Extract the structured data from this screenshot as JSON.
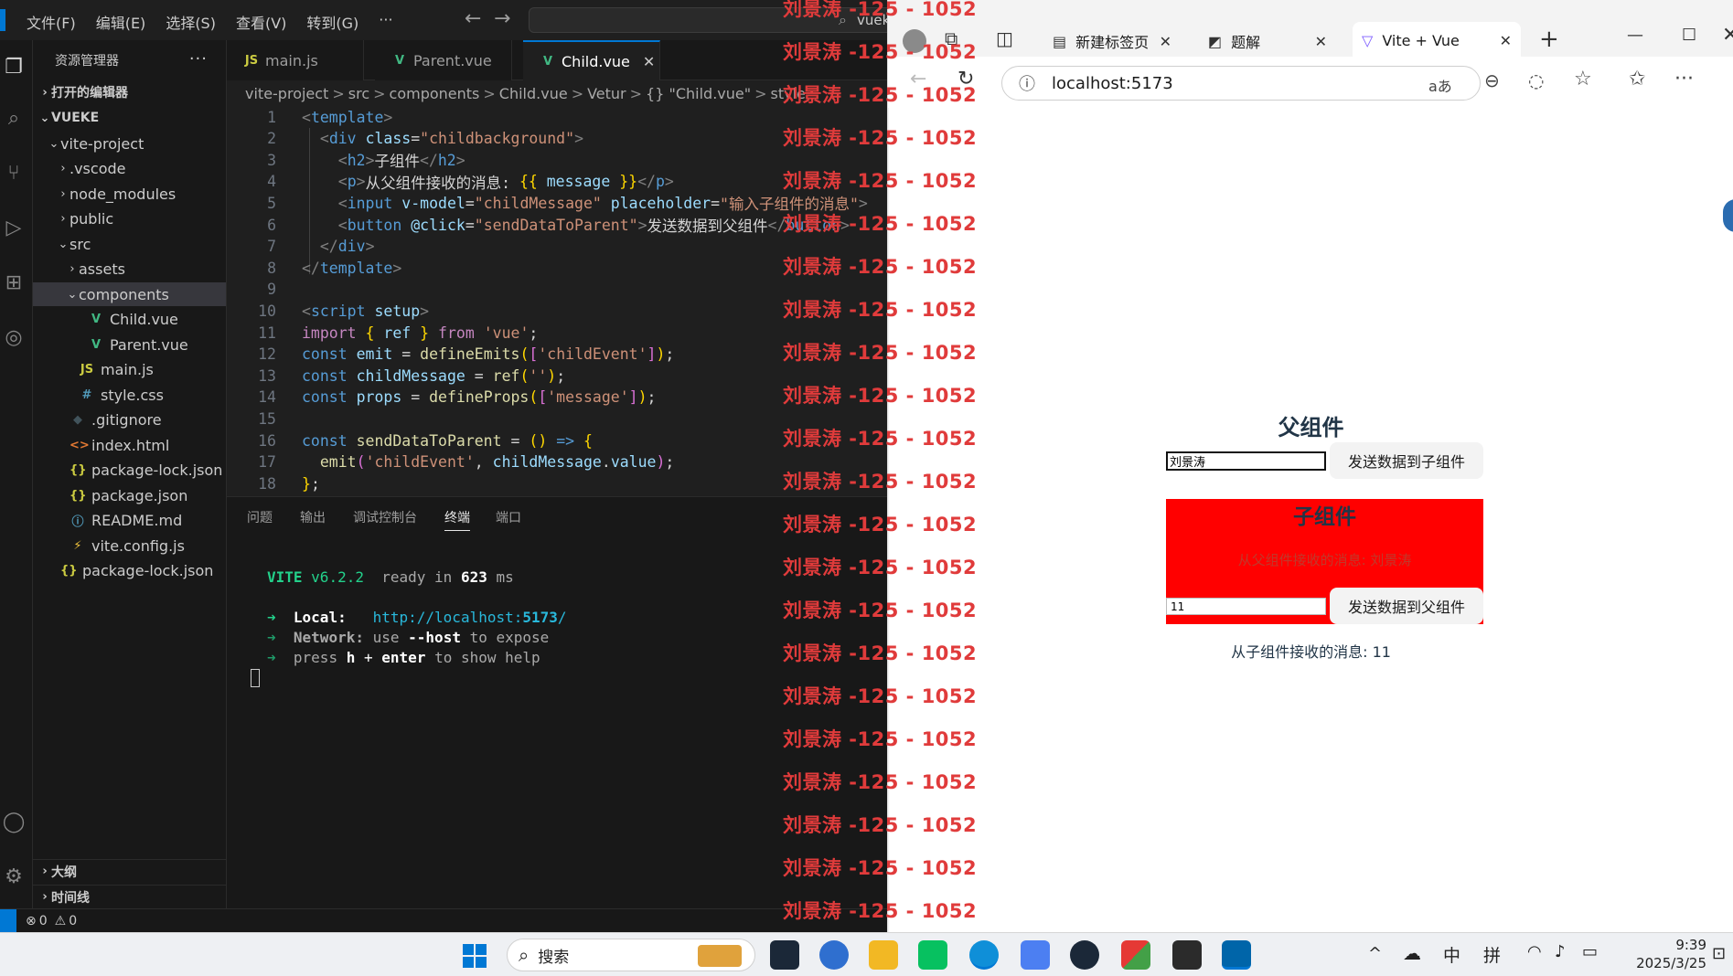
{
  "vscode": {
    "menu": [
      "文件(F)",
      "编辑(E)",
      "选择(S)",
      "查看(V)",
      "转到(G)",
      "···"
    ],
    "search_text": "vueke",
    "explorer_title": "资源管理器",
    "open_editors": "打开的编辑器",
    "project_root": "VUEKE",
    "tree": [
      {
        "label": "vite-project",
        "indent": 1,
        "chev": "v",
        "icon": "",
        "color": "#ccc"
      },
      {
        "label": ".vscode",
        "indent": 2,
        "chev": ">",
        "icon": "",
        "color": "#ccc"
      },
      {
        "label": "node_modules",
        "indent": 2,
        "chev": ">",
        "icon": "",
        "color": "#ccc"
      },
      {
        "label": "public",
        "indent": 2,
        "chev": ">",
        "icon": "",
        "color": "#ccc"
      },
      {
        "label": "src",
        "indent": 2,
        "chev": "v",
        "icon": "",
        "color": "#ccc"
      },
      {
        "label": "assets",
        "indent": 3,
        "chev": ">",
        "icon": "",
        "color": "#ccc"
      },
      {
        "label": "components",
        "indent": 3,
        "chev": "v",
        "icon": "",
        "color": "#ccc",
        "selected": true
      },
      {
        "label": "Child.vue",
        "indent": 4,
        "chev": "",
        "icon": "V",
        "color": "#41b883"
      },
      {
        "label": "Parent.vue",
        "indent": 4,
        "chev": "",
        "icon": "V",
        "color": "#41b883"
      },
      {
        "label": "main.js",
        "indent": 3,
        "chev": "",
        "icon": "JS",
        "color": "#cbcb41"
      },
      {
        "label": "style.css",
        "indent": 3,
        "chev": "",
        "icon": "#",
        "color": "#519aba"
      },
      {
        "label": ".gitignore",
        "indent": 2,
        "chev": "",
        "icon": "◆",
        "color": "#41535b"
      },
      {
        "label": "index.html",
        "indent": 2,
        "chev": "",
        "icon": "<>",
        "color": "#e37933"
      },
      {
        "label": "package-lock.json",
        "indent": 2,
        "chev": "",
        "icon": "{}",
        "color": "#cbcb41"
      },
      {
        "label": "package.json",
        "indent": 2,
        "chev": "",
        "icon": "{}",
        "color": "#cbcb41"
      },
      {
        "label": "README.md",
        "indent": 2,
        "chev": "",
        "icon": "ⓘ",
        "color": "#519aba"
      },
      {
        "label": "vite.config.js",
        "indent": 2,
        "chev": "",
        "icon": "⚡",
        "color": "#f0c33c"
      },
      {
        "label": "package-lock.json",
        "indent": 1,
        "chev": "",
        "icon": "{}",
        "color": "#cbcb41"
      }
    ],
    "outline": "大纲",
    "timeline": "时间线",
    "tabs": [
      {
        "label": "main.js",
        "icon": "JS",
        "color": "#cbcb41"
      },
      {
        "label": "Parent.vue",
        "icon": "V",
        "color": "#41b883"
      },
      {
        "label": "Child.vue",
        "icon": "V",
        "color": "#41b883",
        "active": true,
        "close": "✕"
      }
    ],
    "breadcrumb": [
      "vite-project",
      ">",
      "src",
      ">",
      "components",
      ">",
      "Child.vue",
      ">",
      "Vetur",
      ">",
      "{} \"Child.vue\"",
      ">",
      "style"
    ],
    "code": [
      [
        [
          "t-gray",
          "<"
        ],
        [
          "t-tag",
          "template"
        ],
        [
          "t-gray",
          ">"
        ]
      ],
      [
        [
          "t-pl",
          "  "
        ],
        [
          "t-gray",
          "<"
        ],
        [
          "t-tag",
          "div"
        ],
        [
          "t-pl",
          " "
        ],
        [
          "t-attr",
          "class"
        ],
        [
          "t-pl",
          "="
        ],
        [
          "t-str",
          "\"childbackground\""
        ],
        [
          "t-gray",
          ">"
        ]
      ],
      [
        [
          "t-pl",
          "    "
        ],
        [
          "t-gray",
          "<"
        ],
        [
          "t-tag",
          "h2"
        ],
        [
          "t-gray",
          ">"
        ],
        [
          "t-pl",
          "子组件"
        ],
        [
          "t-gray",
          "</"
        ],
        [
          "t-tag",
          "h2"
        ],
        [
          "t-gray",
          ">"
        ]
      ],
      [
        [
          "t-pl",
          "    "
        ],
        [
          "t-gray",
          "<"
        ],
        [
          "t-tag",
          "p"
        ],
        [
          "t-gray",
          ">"
        ],
        [
          "t-pl",
          "从父组件接收的消息: "
        ],
        [
          "t-mus",
          "{{"
        ],
        [
          "t-pl",
          " "
        ],
        [
          "t-var",
          "message"
        ],
        [
          "t-pl",
          " "
        ],
        [
          "t-mus",
          "}}"
        ],
        [
          "t-gray",
          "</"
        ],
        [
          "t-tag",
          "p"
        ],
        [
          "t-gray",
          ">"
        ]
      ],
      [
        [
          "t-pl",
          "    "
        ],
        [
          "t-gray",
          "<"
        ],
        [
          "t-tag",
          "input"
        ],
        [
          "t-pl",
          " "
        ],
        [
          "t-attr",
          "v-model"
        ],
        [
          "t-pl",
          "="
        ],
        [
          "t-str",
          "\"childMessage\""
        ],
        [
          "t-pl",
          " "
        ],
        [
          "t-attr",
          "placeholder"
        ],
        [
          "t-pl",
          "="
        ],
        [
          "t-str",
          "\"输入子组件的消息\""
        ],
        [
          "t-gray",
          ">"
        ]
      ],
      [
        [
          "t-pl",
          "    "
        ],
        [
          "t-gray",
          "<"
        ],
        [
          "t-tag",
          "button"
        ],
        [
          "t-pl",
          " "
        ],
        [
          "t-attr",
          "@click"
        ],
        [
          "t-pl",
          "="
        ],
        [
          "t-str",
          "\"sendDataToParent\""
        ],
        [
          "t-gray",
          ">"
        ],
        [
          "t-pl",
          "发送数据到父组件"
        ],
        [
          "t-gray",
          "</"
        ],
        [
          "t-tag",
          "button"
        ],
        [
          "t-gray",
          ">"
        ]
      ],
      [
        [
          "t-pl",
          "  "
        ],
        [
          "t-gray",
          "</"
        ],
        [
          "t-tag",
          "div"
        ],
        [
          "t-gray",
          ">"
        ]
      ],
      [
        [
          "t-gray",
          "</"
        ],
        [
          "t-tag",
          "template"
        ],
        [
          "t-gray",
          ">"
        ]
      ],
      [],
      [
        [
          "t-gray",
          "<"
        ],
        [
          "t-tag",
          "script"
        ],
        [
          "t-pl",
          " "
        ],
        [
          "t-attr",
          "setup"
        ],
        [
          "t-gray",
          ">"
        ]
      ],
      [
        [
          "t-kw",
          "import"
        ],
        [
          "t-pl",
          " "
        ],
        [
          "t-br",
          "{"
        ],
        [
          "t-pl",
          " "
        ],
        [
          "t-var",
          "ref"
        ],
        [
          "t-pl",
          " "
        ],
        [
          "t-br",
          "}"
        ],
        [
          "t-pl",
          " "
        ],
        [
          "t-kw",
          "from"
        ],
        [
          "t-pl",
          " "
        ],
        [
          "t-str",
          "'vue'"
        ],
        [
          "t-pl",
          ";"
        ]
      ],
      [
        [
          "t-def",
          "const"
        ],
        [
          "t-pl",
          " "
        ],
        [
          "t-var",
          "emit"
        ],
        [
          "t-pl",
          " = "
        ],
        [
          "t-fn",
          "defineEmits"
        ],
        [
          "t-br",
          "("
        ],
        [
          "t-br2",
          "["
        ],
        [
          "t-str",
          "'childEvent'"
        ],
        [
          "t-br2",
          "]"
        ],
        [
          "t-br",
          ")"
        ],
        [
          "t-pl",
          ";"
        ]
      ],
      [
        [
          "t-def",
          "const"
        ],
        [
          "t-pl",
          " "
        ],
        [
          "t-var",
          "childMessage"
        ],
        [
          "t-pl",
          " = "
        ],
        [
          "t-fn",
          "ref"
        ],
        [
          "t-br",
          "("
        ],
        [
          "t-str",
          "''"
        ],
        [
          "t-br",
          ")"
        ],
        [
          "t-pl",
          ";"
        ]
      ],
      [
        [
          "t-def",
          "const"
        ],
        [
          "t-pl",
          " "
        ],
        [
          "t-var",
          "props"
        ],
        [
          "t-pl",
          " = "
        ],
        [
          "t-fn",
          "defineProps"
        ],
        [
          "t-br",
          "("
        ],
        [
          "t-br2",
          "["
        ],
        [
          "t-str",
          "'message'"
        ],
        [
          "t-br2",
          "]"
        ],
        [
          "t-br",
          ")"
        ],
        [
          "t-pl",
          ";"
        ]
      ],
      [],
      [
        [
          "t-def",
          "const"
        ],
        [
          "t-pl",
          " "
        ],
        [
          "t-fn",
          "sendDataToParent"
        ],
        [
          "t-pl",
          " = "
        ],
        [
          "t-br",
          "("
        ],
        [
          "t-br",
          ")"
        ],
        [
          "t-pl",
          " "
        ],
        [
          "t-def",
          "=>"
        ],
        [
          "t-pl",
          " "
        ],
        [
          "t-br",
          "{"
        ]
      ],
      [
        [
          "t-pl",
          "  "
        ],
        [
          "t-fn",
          "emit"
        ],
        [
          "t-br2",
          "("
        ],
        [
          "t-str",
          "'childEvent'"
        ],
        [
          "t-pl",
          ", "
        ],
        [
          "t-var",
          "childMessage"
        ],
        [
          "t-pl",
          "."
        ],
        [
          "t-var",
          "value"
        ],
        [
          "t-br2",
          ")"
        ],
        [
          "t-pl",
          ";"
        ]
      ],
      [
        [
          "t-br",
          "}"
        ],
        [
          "t-pl",
          ";"
        ]
      ]
    ],
    "panel_tabs": [
      "问题",
      "输出",
      "调试控制台",
      "终端",
      "端口"
    ],
    "panel_active": 3,
    "terminal": {
      "vite": "VITE",
      "version": "v6.2.2",
      "ready": "ready in",
      "ms_value": "623",
      "ms_unit": "ms",
      "local_label": "Local:",
      "local_url_a": "http://localhost:",
      "local_url_port": "5173",
      "local_url_b": "/",
      "network_label": "Network:",
      "network_text_a": "use",
      "network_host": "--host",
      "network_text_b": "to expose",
      "press": "press",
      "h": "h",
      "plus": "+",
      "enter": "enter",
      "help": "to show help"
    },
    "status": {
      "errors": "0",
      "warnings": "0"
    }
  },
  "browser": {
    "tabs": [
      {
        "label": "新建标签页",
        "icon": "▤",
        "close": "✕"
      },
      {
        "label": "题解",
        "icon": "◩",
        "close": "✕"
      },
      {
        "label": "Vite + Vue",
        "icon": "▽",
        "close": "✕",
        "active": true
      }
    ],
    "new_tab": "+",
    "url": "localhost:5173",
    "read_aloud": "aあ",
    "page": {
      "parent_title": "父组件",
      "parent_input_value": "刘景涛",
      "parent_button": "发送数据到子组件",
      "child_title": "子组件",
      "child_received_label": "从父组件接收的消息:",
      "child_received_value": "刘景涛",
      "child_input_value": "11",
      "child_button": "发送数据到父组件",
      "parent_received_label": "从子组件接收的消息:",
      "parent_received_value": "11"
    }
  },
  "watermark": {
    "text": "刘景涛 -125 - 1052",
    "color": "#e03b3b"
  },
  "taskbar": {
    "search_placeholder": "搜索",
    "ime_mode": "中",
    "ime_name": "拼",
    "time": "9:39",
    "date": "2025/3/25"
  }
}
